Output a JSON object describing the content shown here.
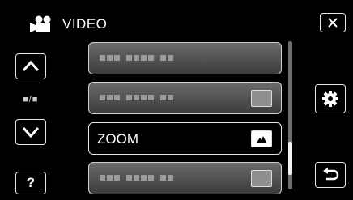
{
  "header": {
    "title": "VIDEO",
    "icon": "movie-camera-icon"
  },
  "nav": {
    "up_icon": "chevron-up-icon",
    "page_indicator": "■/■",
    "down_icon": "chevron-down-icon",
    "help_label": "?"
  },
  "menu": {
    "items": [
      {
        "label": "",
        "obscured": true,
        "has_value_icon": false
      },
      {
        "label": "",
        "obscured": true,
        "has_value_icon": true
      },
      {
        "label": "ZOOM",
        "obscured": false,
        "has_value_icon": true,
        "selected": true,
        "value_icon": "zoom-setting-icon"
      },
      {
        "label": "",
        "obscured": true,
        "has_value_icon": true
      }
    ]
  },
  "actions": {
    "close_icon": "close-icon",
    "settings_icon": "gear-icon",
    "back_icon": "return-arrow-icon"
  },
  "colors": {
    "background": "#000000",
    "item": "#555555",
    "border": "#e6e6e6"
  }
}
